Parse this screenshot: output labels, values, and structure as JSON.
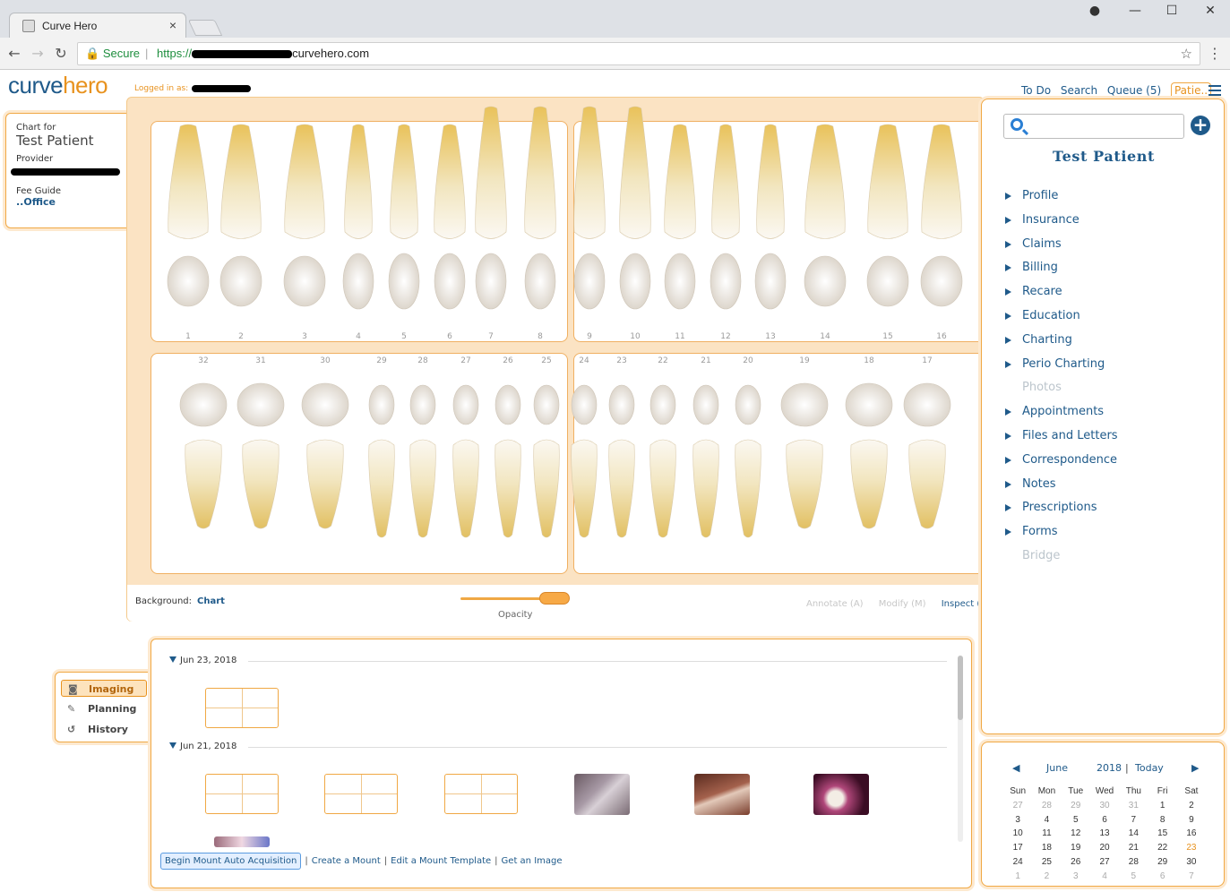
{
  "browser": {
    "tab_title": "Curve Hero",
    "tab_close": "×",
    "url_secure": "Secure",
    "url_prefix": "https://",
    "url_suffix": "curvehero.com",
    "icons": [
      "back-icon",
      "forward-icon",
      "reload-icon",
      "lock-icon",
      "star-icon",
      "kebab-icon",
      "account-icon",
      "minimize-icon",
      "maximize-icon",
      "close-icon"
    ]
  },
  "app": {
    "logo_part1": "curve",
    "logo_part2": "hero",
    "logged_in_label": "Logged in as:",
    "nav": [
      "To Do",
      "Search",
      "Queue (5)",
      "Patie.."
    ],
    "colors": {
      "brand_blue": "#1f5a8a",
      "brand_orange": "#e8921e",
      "panel_bg": "#fbe3c3"
    }
  },
  "chart_for": {
    "label": "Chart for",
    "patient": "Test Patient",
    "provider_label": "Provider",
    "fee_guide_label": "Fee Guide",
    "fee_guide_value": "..Office"
  },
  "tooth_chart": {
    "upper_numbers": [
      "1",
      "2",
      "3",
      "4",
      "5",
      "6",
      "7",
      "8",
      "9",
      "10",
      "11",
      "12",
      "13",
      "14",
      "15",
      "16"
    ],
    "lower_numbers": [
      "32",
      "31",
      "30",
      "29",
      "28",
      "27",
      "26",
      "25",
      "24",
      "23",
      "22",
      "21",
      "20",
      "19",
      "18",
      "17"
    ],
    "background_label": "Background:",
    "background_value": "Chart",
    "opacity_label": "Opacity",
    "opacity_level": 1.0,
    "tools": [
      "Annotate (A)",
      "Modify (M)",
      "Inspect ("
    ]
  },
  "patient_panel": {
    "name": "Test Patient",
    "menu": [
      {
        "label": "Profile",
        "enabled": true
      },
      {
        "label": "Insurance",
        "enabled": true
      },
      {
        "label": "Claims",
        "enabled": true
      },
      {
        "label": "Billing",
        "enabled": true
      },
      {
        "label": "Recare",
        "enabled": true
      },
      {
        "label": "Education",
        "enabled": true
      },
      {
        "label": "Charting",
        "enabled": true
      },
      {
        "label": "Perio Charting",
        "enabled": true
      },
      {
        "label": "Photos",
        "enabled": false
      },
      {
        "label": "Appointments",
        "enabled": true
      },
      {
        "label": "Files and Letters",
        "enabled": true
      },
      {
        "label": "Correspondence",
        "enabled": true
      },
      {
        "label": "Notes",
        "enabled": true
      },
      {
        "label": "Prescriptions",
        "enabled": true
      },
      {
        "label": "Forms",
        "enabled": true
      },
      {
        "label": "Bridge",
        "enabled": false
      }
    ]
  },
  "calendar": {
    "month": "June",
    "year": "2018",
    "today_label": "Today",
    "weekdays": [
      "Sun",
      "Mon",
      "Tue",
      "Wed",
      "Thu",
      "Fri",
      "Sat"
    ],
    "weeks": [
      [
        "27",
        "28",
        "29",
        "30",
        "31",
        "1",
        "2"
      ],
      [
        "3",
        "4",
        "5",
        "6",
        "7",
        "8",
        "9"
      ],
      [
        "10",
        "11",
        "12",
        "13",
        "14",
        "15",
        "16"
      ],
      [
        "17",
        "18",
        "19",
        "20",
        "21",
        "22",
        "23"
      ],
      [
        "24",
        "25",
        "26",
        "27",
        "28",
        "29",
        "30"
      ],
      [
        "1",
        "2",
        "3",
        "4",
        "5",
        "6",
        "7"
      ]
    ],
    "today": "23"
  },
  "side_tabs": [
    "Imaging",
    "Planning",
    "History"
  ],
  "imaging": {
    "groups": [
      {
        "date": "Jun 23, 2018"
      },
      {
        "date": "Jun 21, 2018"
      }
    ],
    "actions": [
      "Begin Mount Auto Acquisition",
      "Create a Mount",
      "Edit a Mount Template",
      "Get an Image"
    ]
  }
}
